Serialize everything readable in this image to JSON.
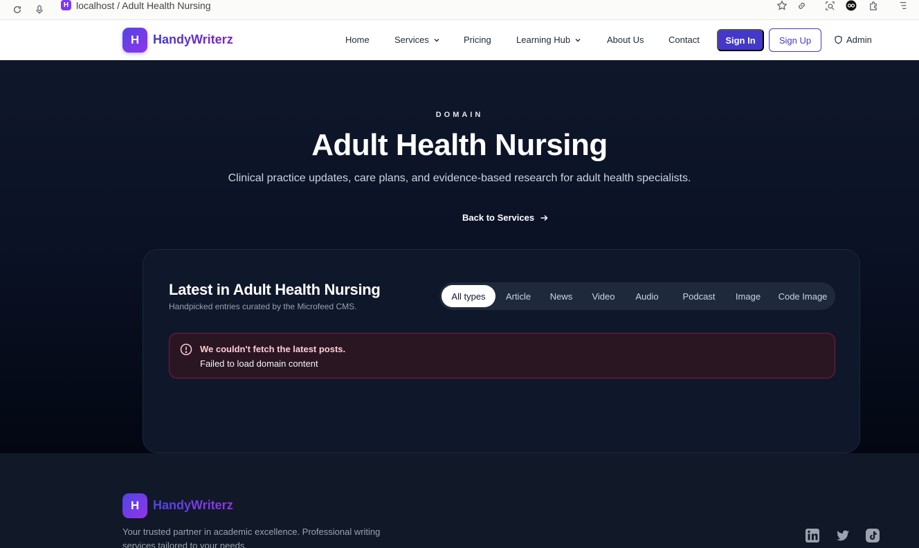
{
  "browser": {
    "url_text": "localhost / Adult Health Nursing",
    "favicon_letter": "H"
  },
  "nav": {
    "logo_letter": "H",
    "brand": "HandyWriterz",
    "links": [
      "Home",
      "Services",
      "Pricing",
      "Learning Hub",
      "About Us",
      "Contact"
    ],
    "sign_in": "Sign In",
    "sign_up": "Sign Up",
    "admin": "Admin"
  },
  "hero": {
    "eyebrow": "DOMAIN",
    "title": "Adult Health Nursing",
    "subtitle": "Clinical practice updates, care plans, and evidence-based research for adult health specialists.",
    "back_link": "Back to Services"
  },
  "content": {
    "title": "Latest in Adult Health Nursing",
    "subtitle": "Handpicked entries curated by the Microfeed CMS.",
    "filters": [
      "All types",
      "Article",
      "News",
      "Video",
      "Audio",
      "Podcast",
      "Image",
      "Code Image"
    ],
    "active_filter": "All types",
    "error_title": "We couldn't fetch the latest posts.",
    "error_message": "Failed to load domain content"
  },
  "footer": {
    "logo_letter": "H",
    "brand": "HandyWriterz",
    "description": "Your trusted partner in academic excellence. Professional writing services tailored to your needs.",
    "social_icons": [
      "linkedin-icon",
      "twitter-icon",
      "tiktok-icon"
    ]
  },
  "colors": {
    "brand_primary": "#4338ca",
    "brand_secondary": "#9333ea",
    "hero_bg": "#0b1226",
    "error_bg": "#2a1622"
  }
}
